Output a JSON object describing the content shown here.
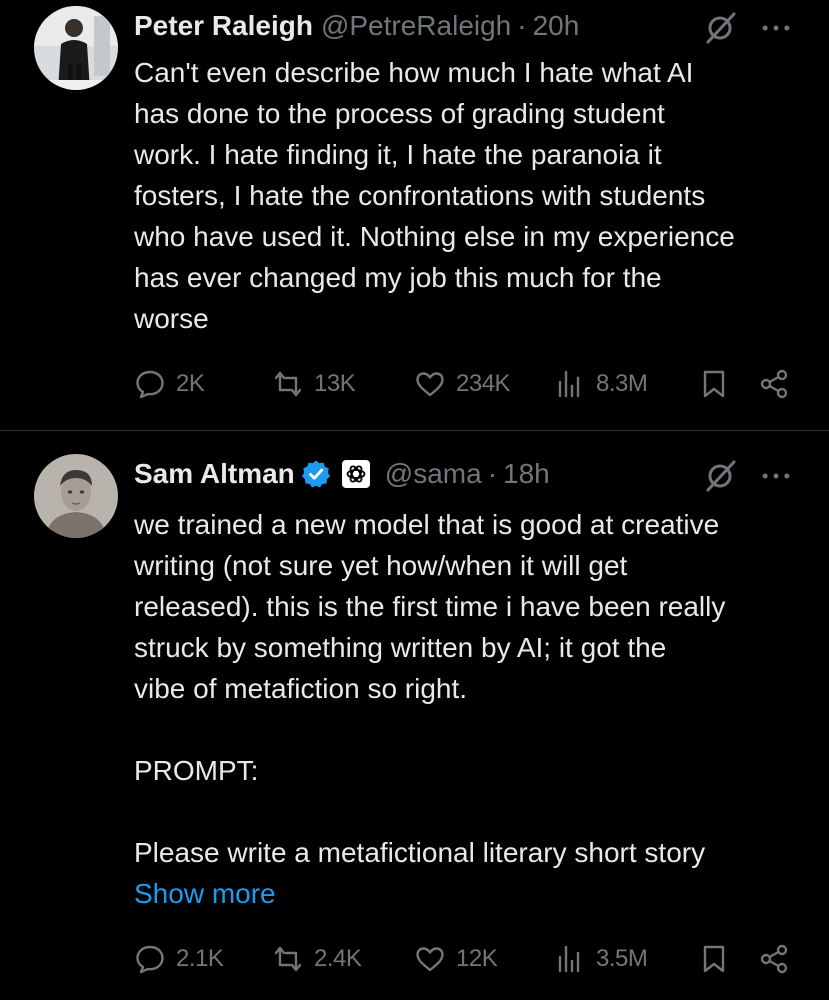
{
  "tweets": [
    {
      "name": "Peter Raleigh",
      "handle": "@PetreRaleigh",
      "separator": "·",
      "time": "20h",
      "text": [
        "Can't even describe how much I hate what AI",
        "has done to the process of grading student",
        "work. I hate finding it, I hate the paranoia it",
        "fosters, I hate the confrontations with students",
        "who have used it. Nothing else in my experience",
        "has ever changed my job this much for the",
        "worse"
      ],
      "replies": "2K",
      "retweets": "13K",
      "likes": "234K",
      "views": "8.3M"
    },
    {
      "name": "Sam Altman",
      "handle": "@sama",
      "separator": "·",
      "time": "18h",
      "verified": true,
      "text_p1": [
        "we trained a new model that is good at creative",
        "writing (not sure yet how/when it will get",
        "released). this is the first time i have been really",
        "struck by something written by AI; it got the",
        "vibe of metafiction so right."
      ],
      "text_p2": "PROMPT:",
      "text_p3": "Please write a metafictional literary short story",
      "show_more": "Show more",
      "replies": "2.1K",
      "retweets": "2.4K",
      "likes": "12K",
      "views": "3.5M"
    }
  ],
  "colors": {
    "background": "#000000",
    "text": "#e7e9ea",
    "secondary": "#71767b",
    "link": "#1d9bf0",
    "verified": "#1d9bf0",
    "divider": "#2f3336"
  },
  "icons": [
    "grok-icon",
    "more-icon",
    "reply-icon",
    "retweet-icon",
    "like-icon",
    "views-icon",
    "bookmark-icon",
    "share-icon",
    "verified-badge-icon",
    "openai-logo-icon"
  ]
}
